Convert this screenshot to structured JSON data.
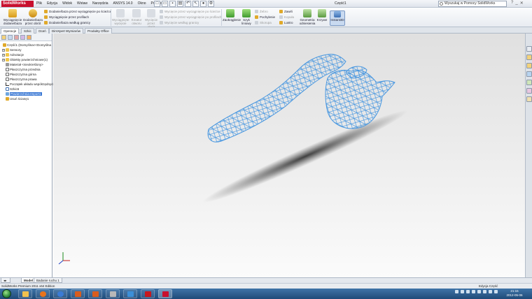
{
  "app": {
    "logo_text": "SolidWorks",
    "document_title": "Część1"
  },
  "menu": [
    "Plik",
    "Edycja",
    "Widok",
    "Wstaw",
    "Narzędzia",
    "ANSYS 14.0",
    "Okno",
    "Pomoc"
  ],
  "help_search": {
    "placeholder": "Wyszukaj w Pomocy SolidWorks"
  },
  "ribbon": {
    "extrude_boss": "Wyciągnięcie dodane/baza",
    "revolve_boss": "Dodanie/baza przez obrót",
    "sweep_boss": "Dodanie/baza przez wyciągnięcie po ścieżce",
    "loft_boss": "Wyciągnięcie przez profilach",
    "boundary_boss": "Dodanie/baza według granicy",
    "extrude_cut": "Wyciągnięte wycięcie",
    "hole_wizard": "Kreator otworu",
    "revolve_cut": "Wycięcie przez obrót",
    "sweep_cut": "Wycięcie przez wyciągnięcie po ścieżce",
    "loft_cut": "Wycięcie przez wyciągnięcie po profilach",
    "boundary_cut": "Wycięcie według granicy",
    "fillet": "Zaokrąglenie",
    "linear_pattern": "Szyk liniowy",
    "rib": "Żebro",
    "draft": "Pochylenie",
    "shell": "Skorupa",
    "wrap": "Zawiń",
    "dome": "Kopuła",
    "mirror": "Lustro",
    "ref_geometry": "Geometria odniesienia",
    "curves": "Krzywe",
    "instant3d": "Instant3D"
  },
  "tabs": [
    "Operacje",
    "Szkic",
    "Oceń",
    "DimXpert Wymiarów",
    "Produkty Office"
  ],
  "tree": {
    "root": "Część1  (Domyślna<<Domyślna",
    "items": [
      "Sensory",
      "Adnotacje",
      "Obiekty powierzchniowe(1)",
      "Materiał <nieokreślony>",
      "Płaszczyzna przednia",
      "Płaszczyzna górna",
      "Płaszczyzna prawa",
      "Początek układu współrzędnych",
      "Szkic6",
      "Powierzchnia-Import1",
      "Usuń ścianę1"
    ]
  },
  "bottom_tabs": [
    "Model",
    "Badanie ruchu 1"
  ],
  "status": {
    "left": "SolidWorks Premium 2011 x64 Edition",
    "right": "Edycja Część"
  },
  "clock": {
    "time": "21:15",
    "date": "2012-05-06"
  },
  "colors": {
    "wireframe": "#4a98e0",
    "selection": "#3a78d4",
    "logo": "#c8102e",
    "taskbar": "#2b5c8f"
  }
}
